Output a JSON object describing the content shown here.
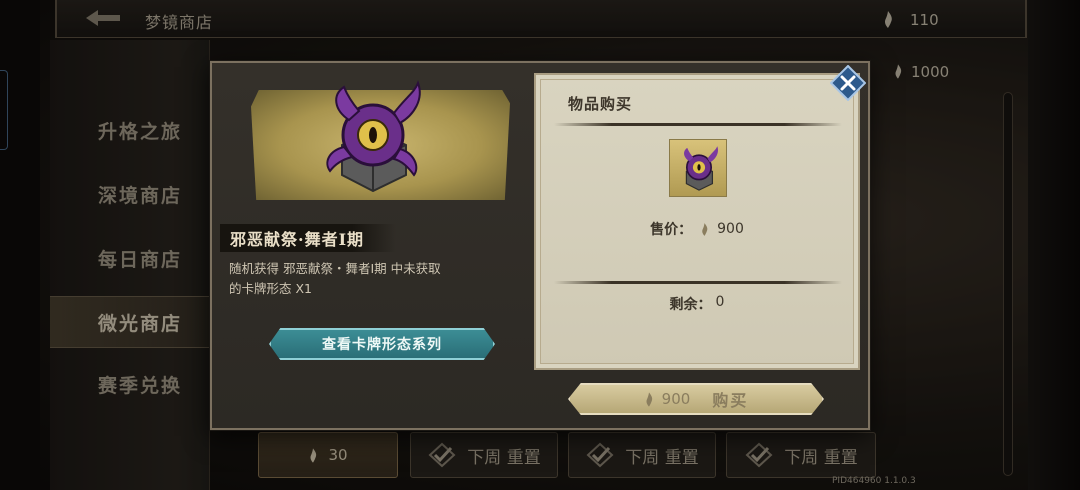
{
  "topbar": {
    "title": "梦镜商店",
    "currency_icon": "soul-flame-icon",
    "currency_value": "110"
  },
  "background": {
    "currency_value": "1000"
  },
  "nav": {
    "items": [
      {
        "label": "升格之旅",
        "active": false
      },
      {
        "label": "深境商店",
        "active": false
      },
      {
        "label": "每日商店",
        "active": false
      },
      {
        "label": "微光商店",
        "active": true
      },
      {
        "label": "赛季兑换",
        "active": false
      }
    ]
  },
  "bottom_cards": [
    {
      "price": "30"
    },
    {
      "label": "下周 重置"
    },
    {
      "label": "下周 重置"
    },
    {
      "label": "下周 重置"
    }
  ],
  "footer": {
    "pid": "PID464960  1.1.0.3"
  },
  "modal": {
    "item_name": "邪恶献祭·舞者I期",
    "item_desc_line1": "随机获得 邪恶献祭・舞者I期 中未获取",
    "item_desc_line2": "的卡牌形态 X1",
    "series_button": "查看卡牌形态系列",
    "purchase": {
      "title": "物品购买",
      "price_label": "售价：",
      "price_value": "900",
      "remain_label": "剩余：",
      "remain_value": "0"
    },
    "buy_button": {
      "price": "900",
      "label": "购买"
    }
  },
  "colors": {
    "accent_teal": "#2a6e77",
    "gold": "#c9b56e",
    "close_blue": "#3a6ea8"
  }
}
